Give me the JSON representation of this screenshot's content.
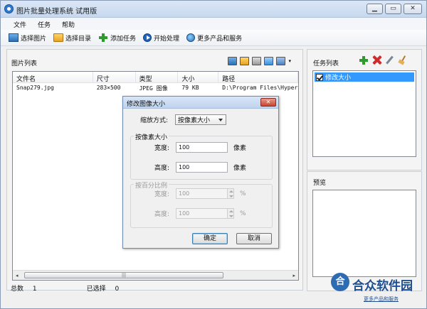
{
  "window": {
    "title": "图片批量处理系统 试用版",
    "controls": [
      "▁",
      "▭",
      "✕"
    ]
  },
  "menu": [
    "文件",
    "任务",
    "帮助"
  ],
  "toolbar": {
    "select_images": "选择图片",
    "select_dir": "选择目录",
    "add_task": "添加任务",
    "start": "开始处理",
    "more": "更多产品和服务"
  },
  "image_list": {
    "title": "图片列表",
    "columns": [
      "文件名",
      "尺寸",
      "类型",
      "大小",
      "路径"
    ],
    "rows": [
      [
        "Snap279.jpg",
        "283×500",
        "JPEG 图像",
        "79 KB",
        "D:\\Program Files\\HyperSn"
      ]
    ],
    "scroll_grip": "|||"
  },
  "status": {
    "total_label": "总数",
    "total_value": "1",
    "selected_label": "已选择",
    "selected_value": "0"
  },
  "task_list": {
    "title": "任务列表",
    "items": [
      "修改大小"
    ]
  },
  "preview": {
    "title": "预览"
  },
  "dialog": {
    "title": "修改图像大小",
    "close": "✕",
    "mode_label": "缩放方式:",
    "mode_value": "按像素大小",
    "pixel_group": "按像素大小",
    "width_label": "宽度:",
    "width_value": "100",
    "height_label": "高度:",
    "height_value": "100",
    "pixel_unit": "像素",
    "percent_group": "按百分比例",
    "pwidth_label": "宽度:",
    "pwidth_value": "100",
    "pheight_label": "高度:",
    "pheight_value": "100",
    "percent_unit": "%",
    "ok": "确定",
    "cancel": "取消"
  },
  "watermark": {
    "logo": "合",
    "text": "合众软件园",
    "sub": "更多产品和服务"
  }
}
